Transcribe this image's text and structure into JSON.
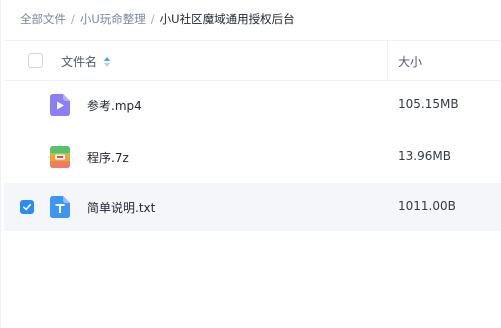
{
  "breadcrumb": {
    "items": [
      "全部文件",
      "小U玩命整理"
    ],
    "separator": "/",
    "current": "小U社区魔域通用授权后台"
  },
  "table": {
    "columns": {
      "name": "文件名",
      "size": "大小"
    },
    "rows": [
      {
        "name": "参考.mp4",
        "size": "105.15MB",
        "icon": "video-file-icon",
        "selected": false
      },
      {
        "name": "程序.7z",
        "size": "13.96MB",
        "icon": "archive-file-icon",
        "selected": false
      },
      {
        "name": "简单说明.txt",
        "size": "1011.00B",
        "icon": "text-file-icon",
        "selected": true
      }
    ]
  },
  "colors": {
    "accent": "#2a8bf2",
    "video_icon": "#8b7ff6",
    "archive_icon": "#f2a33a",
    "text_icon": "#3d95f5",
    "selected_row": "#f4f6fa"
  }
}
